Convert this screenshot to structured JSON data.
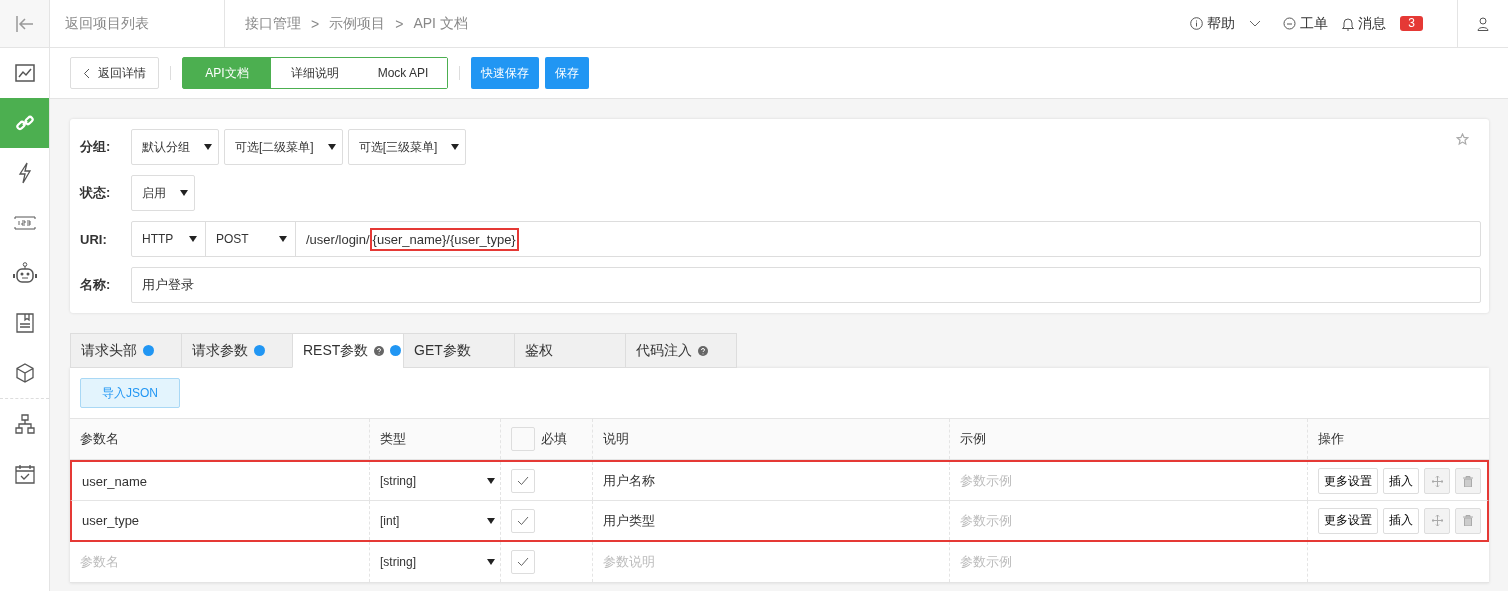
{
  "header": {
    "back_link": "返回项目列表",
    "breadcrumb": [
      "接口管理",
      "示例项目",
      "API 文档"
    ],
    "separator": ">",
    "help": "帮助",
    "ticket": "工单",
    "messages": "消息",
    "message_count": "3"
  },
  "sidebar": {
    "items": [
      {
        "kind": "chart",
        "selected": false
      },
      {
        "kind": "link",
        "selected": true
      },
      {
        "kind": "bolt",
        "selected": false
      },
      {
        "kind": "numbers",
        "selected": false
      },
      {
        "kind": "robot",
        "selected": false
      },
      {
        "kind": "document",
        "selected": false
      },
      {
        "kind": "cube",
        "selected": false
      },
      {
        "kind": "divider"
      },
      {
        "kind": "hierarchy",
        "selected": false
      },
      {
        "kind": "calendar",
        "selected": false
      }
    ]
  },
  "toolbar": {
    "back": "返回详情",
    "view_tabs": [
      {
        "label": "API文档",
        "selected": true
      },
      {
        "label": "详细说明",
        "selected": false
      },
      {
        "label": "Mock API",
        "selected": false
      }
    ],
    "buttons": [
      "快速保存",
      "保存"
    ]
  },
  "form": {
    "group_label": "分组:",
    "groups": [
      "默认分组",
      "可选[二级菜单]",
      "可选[三级菜单]"
    ],
    "status_label": "状态:",
    "status": "启用",
    "uri_label": "URI:",
    "protocol": "HTTP",
    "method": "POST",
    "uri_prefix": "/user/login/",
    "uri_highlight": "{user_name}/{user_type}",
    "name_label": "名称:",
    "name": "用户登录"
  },
  "tabs": [
    {
      "label": "请求头部",
      "help": false,
      "dot": true,
      "selected": false
    },
    {
      "label": "请求参数",
      "help": false,
      "dot": true,
      "selected": false
    },
    {
      "label": "REST参数",
      "help": true,
      "dot": true,
      "selected": true
    },
    {
      "label": "GET参数",
      "help": false,
      "dot": false,
      "selected": false
    },
    {
      "label": "鉴权",
      "help": false,
      "dot": false,
      "selected": false
    },
    {
      "label": "代码注入",
      "help": true,
      "dot": false,
      "selected": false
    }
  ],
  "import_button": "导入JSON",
  "table": {
    "columns": [
      "参数名",
      "类型",
      "必填",
      "说明",
      "示例",
      "操作"
    ],
    "header_checked": false,
    "rows": [
      {
        "name": "user_name",
        "type": "[string]",
        "required": true,
        "description": "用户名称",
        "example_placeholder": "参数示例",
        "actions": [
          "更多设置",
          "插入"
        ],
        "highlighted": true
      },
      {
        "name": "user_type",
        "type": "[int]",
        "required": true,
        "description": "用户类型",
        "example_placeholder": "参数示例",
        "actions": [
          "更多设置",
          "插入"
        ],
        "highlighted": true
      },
      {
        "name_placeholder": "参数名",
        "type": "[string]",
        "required": true,
        "description_placeholder": "参数说明",
        "example_placeholder": "参数示例",
        "highlighted": false
      }
    ]
  }
}
